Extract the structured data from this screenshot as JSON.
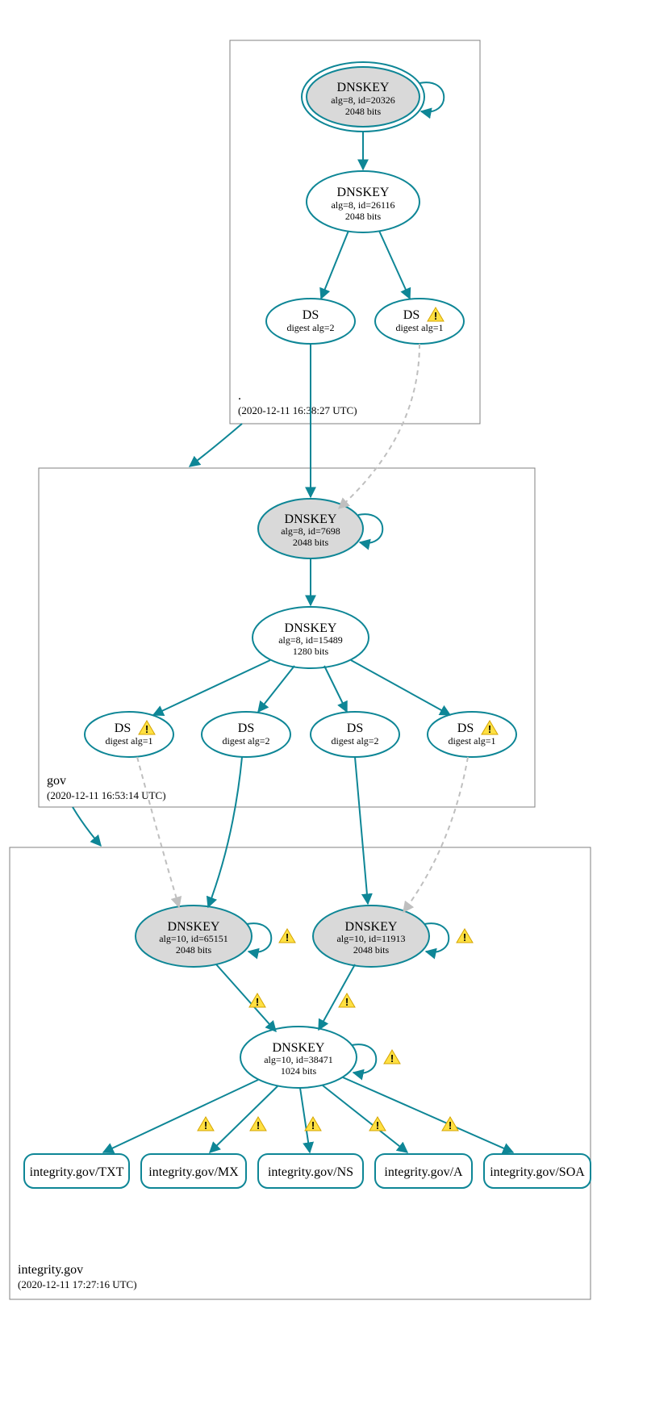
{
  "colors": {
    "teal": "#0e8696",
    "grayFill": "#d9d9d9",
    "grayStroke": "#808080",
    "lightGray": "#bfbfbf",
    "black": "#000000",
    "white": "#ffffff"
  },
  "zones": {
    "root": {
      "label": ".",
      "timestamp": "(2020-12-11 16:38:27 UTC)"
    },
    "gov": {
      "label": "gov",
      "timestamp": "(2020-12-11 16:53:14 UTC)"
    },
    "integrity": {
      "label": "integrity.gov",
      "timestamp": "(2020-12-11 17:27:16 UTC)"
    }
  },
  "nodes": {
    "root_ksk": {
      "title": "DNSKEY",
      "line1": "alg=8, id=20326",
      "line2": "2048 bits"
    },
    "root_zsk": {
      "title": "DNSKEY",
      "line1": "alg=8, id=26116",
      "line2": "2048 bits"
    },
    "root_ds1": {
      "title": "DS",
      "line1": "digest alg=2"
    },
    "root_ds2": {
      "title": "DS",
      "line1": "digest alg=1"
    },
    "gov_ksk": {
      "title": "DNSKEY",
      "line1": "alg=8, id=7698",
      "line2": "2048 bits"
    },
    "gov_zsk": {
      "title": "DNSKEY",
      "line1": "alg=8, id=15489",
      "line2": "1280 bits"
    },
    "gov_ds1": {
      "title": "DS",
      "line1": "digest alg=1"
    },
    "gov_ds2": {
      "title": "DS",
      "line1": "digest alg=2"
    },
    "gov_ds3": {
      "title": "DS",
      "line1": "digest alg=2"
    },
    "gov_ds4": {
      "title": "DS",
      "line1": "digest alg=1"
    },
    "int_ksk1": {
      "title": "DNSKEY",
      "line1": "alg=10, id=65151",
      "line2": "2048 bits"
    },
    "int_ksk2": {
      "title": "DNSKEY",
      "line1": "alg=10, id=11913",
      "line2": "2048 bits"
    },
    "int_zsk": {
      "title": "DNSKEY",
      "line1": "alg=10, id=38471",
      "line2": "1024 bits"
    }
  },
  "rr": {
    "txt": "integrity.gov/TXT",
    "mx": "integrity.gov/MX",
    "ns": "integrity.gov/NS",
    "a": "integrity.gov/A",
    "soa": "integrity.gov/SOA"
  }
}
